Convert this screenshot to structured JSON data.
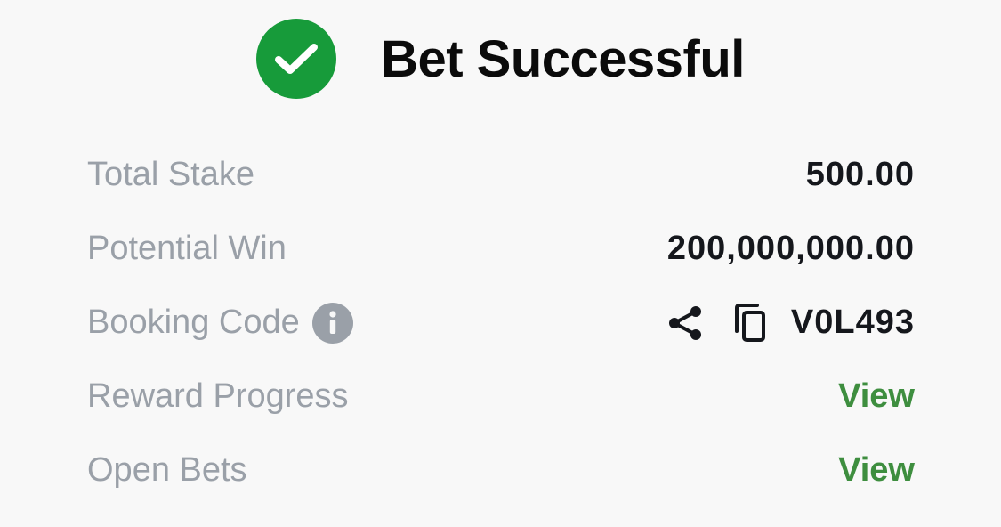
{
  "header": {
    "title": "Bet Successful",
    "icon": "check-circle-icon",
    "success_color": "#179b3a"
  },
  "rows": {
    "total_stake": {
      "label": "Total Stake",
      "value": "500.00"
    },
    "potential_win": {
      "label": "Potential Win",
      "value": "200,000,000.00"
    },
    "booking_code": {
      "label": "Booking Code",
      "value": "V0L493",
      "icons": [
        "info-icon",
        "share-icon",
        "copy-icon"
      ]
    },
    "reward_progress": {
      "label": "Reward Progress",
      "link": "View"
    },
    "open_bets": {
      "label": "Open Bets",
      "link": "View"
    }
  },
  "colors": {
    "label": "#9aa0a8",
    "value": "#15171c",
    "link": "#3e8e3f"
  }
}
